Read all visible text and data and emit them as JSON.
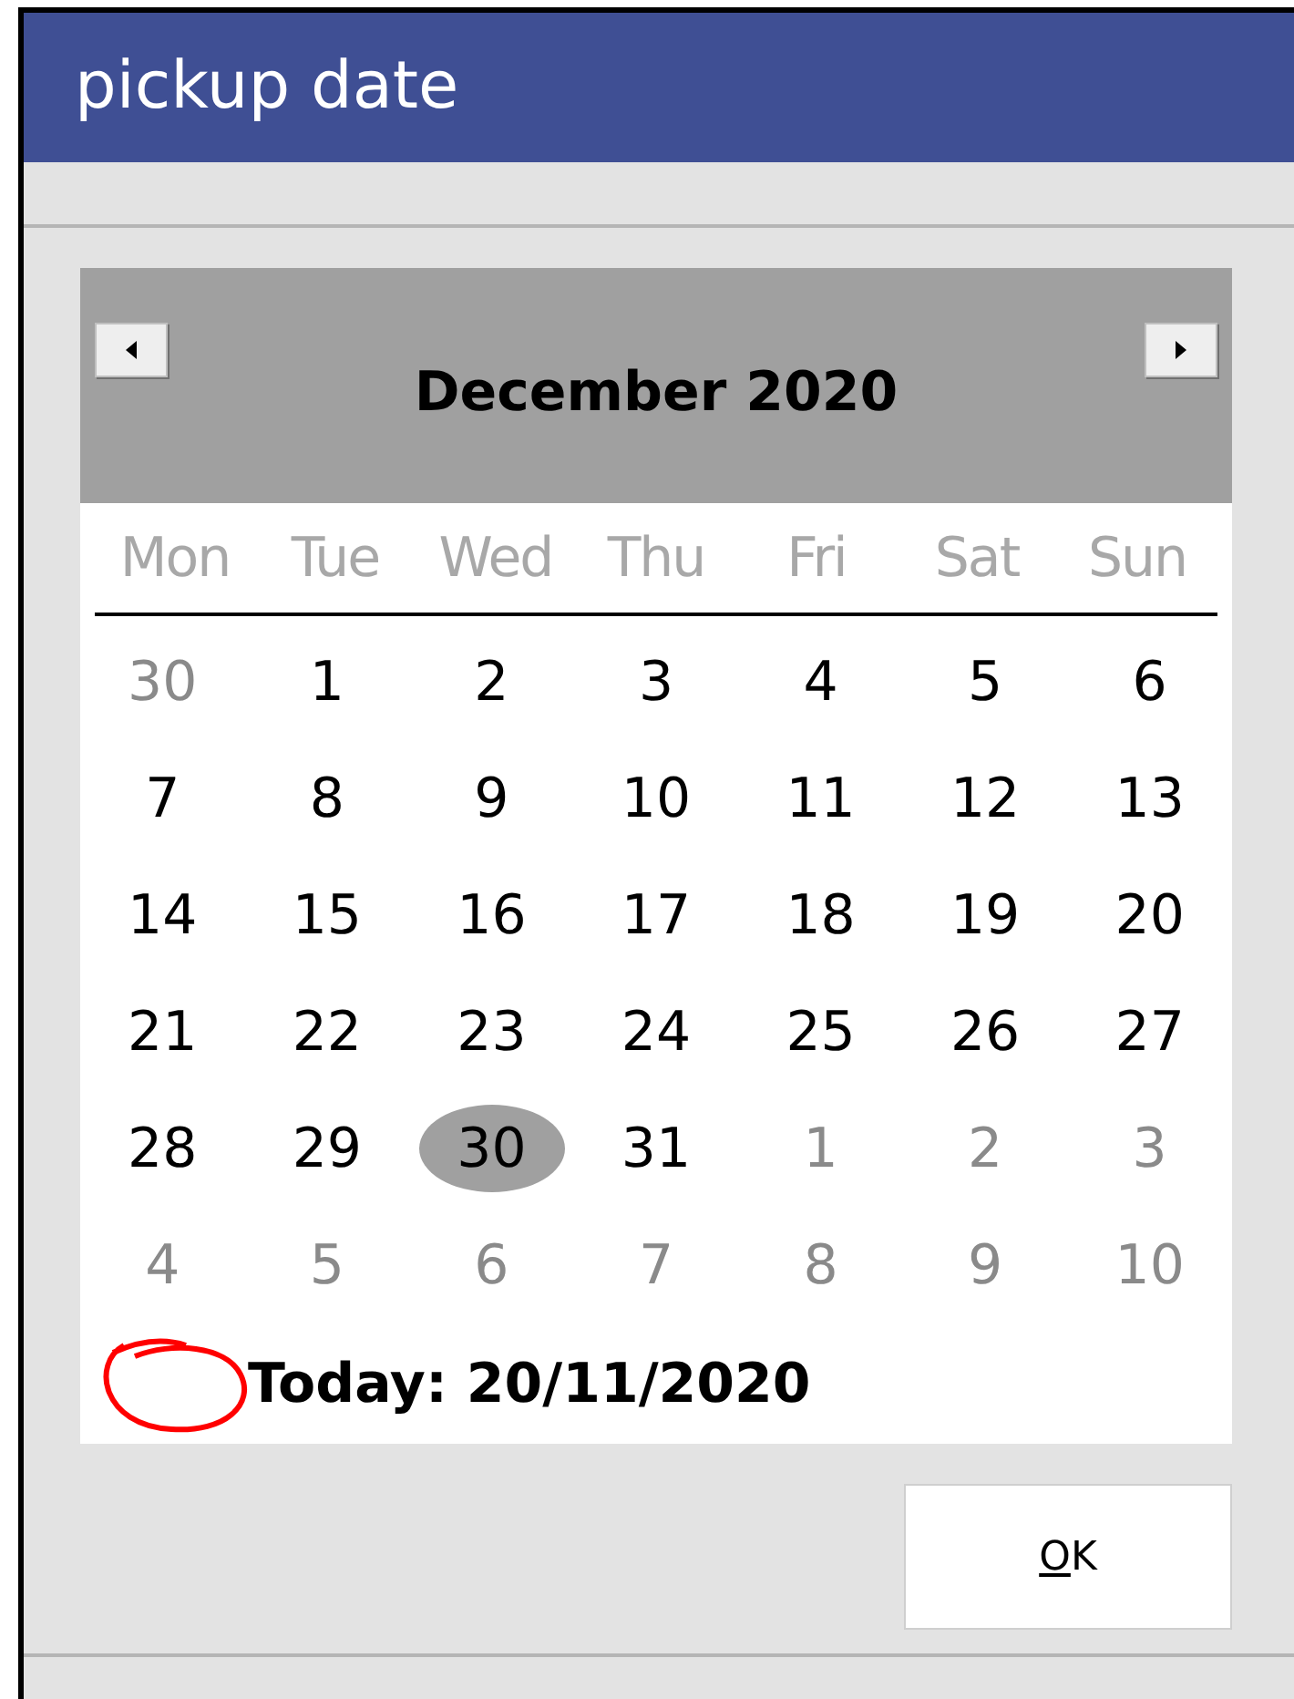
{
  "window": {
    "title": "pickup date"
  },
  "calendar": {
    "month_label": "December 2020",
    "prev_button": true,
    "next_button": true,
    "weekdays": [
      "Mon",
      "Tue",
      "Wed",
      "Thu",
      "Fri",
      "Sat",
      "Sun"
    ],
    "weeks": [
      [
        {
          "day": "30",
          "in_month": false,
          "selected": false
        },
        {
          "day": "1",
          "in_month": true,
          "selected": false
        },
        {
          "day": "2",
          "in_month": true,
          "selected": false
        },
        {
          "day": "3",
          "in_month": true,
          "selected": false
        },
        {
          "day": "4",
          "in_month": true,
          "selected": false
        },
        {
          "day": "5",
          "in_month": true,
          "selected": false
        },
        {
          "day": "6",
          "in_month": true,
          "selected": false
        }
      ],
      [
        {
          "day": "7",
          "in_month": true,
          "selected": false
        },
        {
          "day": "8",
          "in_month": true,
          "selected": false
        },
        {
          "day": "9",
          "in_month": true,
          "selected": false
        },
        {
          "day": "10",
          "in_month": true,
          "selected": false
        },
        {
          "day": "11",
          "in_month": true,
          "selected": false
        },
        {
          "day": "12",
          "in_month": true,
          "selected": false
        },
        {
          "day": "13",
          "in_month": true,
          "selected": false
        }
      ],
      [
        {
          "day": "14",
          "in_month": true,
          "selected": false
        },
        {
          "day": "15",
          "in_month": true,
          "selected": false
        },
        {
          "day": "16",
          "in_month": true,
          "selected": false
        },
        {
          "day": "17",
          "in_month": true,
          "selected": false
        },
        {
          "day": "18",
          "in_month": true,
          "selected": false
        },
        {
          "day": "19",
          "in_month": true,
          "selected": false
        },
        {
          "day": "20",
          "in_month": true,
          "selected": false
        }
      ],
      [
        {
          "day": "21",
          "in_month": true,
          "selected": false
        },
        {
          "day": "22",
          "in_month": true,
          "selected": false
        },
        {
          "day": "23",
          "in_month": true,
          "selected": false
        },
        {
          "day": "24",
          "in_month": true,
          "selected": false
        },
        {
          "day": "25",
          "in_month": true,
          "selected": false
        },
        {
          "day": "26",
          "in_month": true,
          "selected": false
        },
        {
          "day": "27",
          "in_month": true,
          "selected": false
        }
      ],
      [
        {
          "day": "28",
          "in_month": true,
          "selected": false
        },
        {
          "day": "29",
          "in_month": true,
          "selected": false
        },
        {
          "day": "30",
          "in_month": true,
          "selected": true
        },
        {
          "day": "31",
          "in_month": true,
          "selected": false
        },
        {
          "day": "1",
          "in_month": false,
          "selected": false
        },
        {
          "day": "2",
          "in_month": false,
          "selected": false
        },
        {
          "day": "3",
          "in_month": false,
          "selected": false
        }
      ],
      [
        {
          "day": "4",
          "in_month": false,
          "selected": false
        },
        {
          "day": "5",
          "in_month": false,
          "selected": false
        },
        {
          "day": "6",
          "in_month": false,
          "selected": false
        },
        {
          "day": "7",
          "in_month": false,
          "selected": false
        },
        {
          "day": "8",
          "in_month": false,
          "selected": false
        },
        {
          "day": "9",
          "in_month": false,
          "selected": false
        },
        {
          "day": "10",
          "in_month": false,
          "selected": false
        }
      ]
    ],
    "today": {
      "label": "Today: 20/11/2020",
      "circled": true
    }
  },
  "ok_button": {
    "label": "OK",
    "mnemonic_underlined": true
  }
}
